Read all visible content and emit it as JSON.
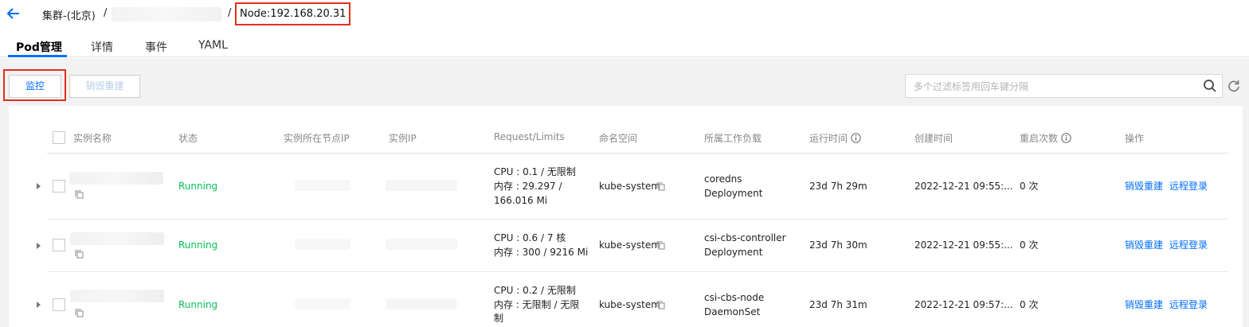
{
  "breadcrumb": {
    "cluster": "集群-(北京)",
    "sep": "/",
    "node": "Node:192.168.20.31"
  },
  "tabs": [
    {
      "label": "Pod管理",
      "active": true
    },
    {
      "label": "详情"
    },
    {
      "label": "事件"
    },
    {
      "label": "YAML"
    }
  ],
  "toolbar": {
    "monitor_label": "监控",
    "destroy_label": "销毁重建",
    "search_placeholder": "多个过滤标签用回车键分隔"
  },
  "table": {
    "headers": {
      "name": "实例名称",
      "status": "状态",
      "node_ip": "实例所在节点IP",
      "pod_ip": "实例IP",
      "req": "Request/Limits",
      "ns": "命名空间",
      "workload": "所属工作负载",
      "runtime": "运行时间",
      "created": "创建时间",
      "restarts": "重启次数",
      "ops": "操作"
    },
    "rows": [
      {
        "status": "Running",
        "req": [
          "CPU : 0.1 / 无限制",
          "内存 : 29.297 /",
          "166.016 Mi"
        ],
        "ns": "kube-system",
        "workload": [
          "coredns",
          "Deployment"
        ],
        "runtime": "23d 7h 29m",
        "created": "2022-12-21 09:55:...",
        "restarts": "0 次",
        "op1": "销毁重建",
        "op2": "远程登录"
      },
      {
        "status": "Running",
        "req": [
          "CPU : 0.6 / 7 核",
          "内存 : 300 / 9216 Mi"
        ],
        "ns": "kube-system",
        "workload": [
          "csi-cbs-controller",
          "Deployment"
        ],
        "runtime": "23d 7h 30m",
        "created": "2022-12-21 09:55:...",
        "restarts": "0 次",
        "op1": "销毁重建",
        "op2": "远程登录"
      },
      {
        "status": "Running",
        "req": [
          "CPU : 0.2 / 无限制",
          "内存 : 无限制 / 无限",
          "制"
        ],
        "ns": "kube-system",
        "workload": [
          "csi-cbs-node",
          "DaemonSet"
        ],
        "runtime": "23d 7h 31m",
        "created": "2022-12-21 09:57:...",
        "restarts": "0 次",
        "op1": "销毁重建",
        "op2": "远程登录"
      }
    ]
  },
  "colors": {
    "accent": "#006eff",
    "running": "#0abf5b",
    "highlight_box": "#e0301e",
    "disabled_text": "#b9cdea"
  }
}
